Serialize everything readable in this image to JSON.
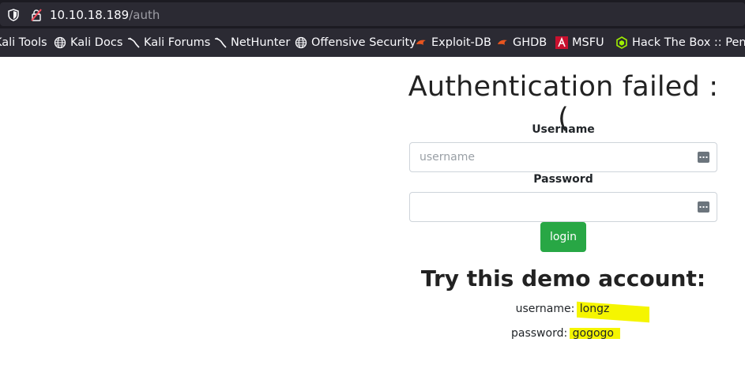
{
  "browser": {
    "url_host": "10.10.18.189",
    "url_path": "/auth"
  },
  "bookmarks": [
    {
      "label": "Kali Tools",
      "icon": "kali-icon"
    },
    {
      "label": "Kali Docs",
      "icon": "globe-icon"
    },
    {
      "label": "Kali Forums",
      "icon": "kali-icon"
    },
    {
      "label": "NetHunter",
      "icon": "kali-icon"
    },
    {
      "label": "Offensive Security",
      "icon": "globe-icon"
    },
    {
      "label": "Exploit-DB",
      "icon": "exploit-db-icon"
    },
    {
      "label": "GHDB",
      "icon": "exploit-db-icon"
    },
    {
      "label": "MSFU",
      "icon": "msfu-icon"
    },
    {
      "label": "Hack The Box :: Penetration",
      "icon": "htb-icon"
    }
  ],
  "auth": {
    "title": "Authentication failed :(",
    "username_label": "Username",
    "username_placeholder": "username",
    "username_value": "",
    "password_label": "Password",
    "password_value": "",
    "login_label": "login"
  },
  "demo": {
    "title": "Try this demo account:",
    "username_label": "username:",
    "username_value": "longz",
    "password_label": "password:",
    "password_value": "gogogo"
  },
  "colors": {
    "chrome_dark": "#1c1b22",
    "chrome_bar": "#2b2a33",
    "login_green": "#28a745",
    "highlight_yellow": "#f5f500"
  }
}
